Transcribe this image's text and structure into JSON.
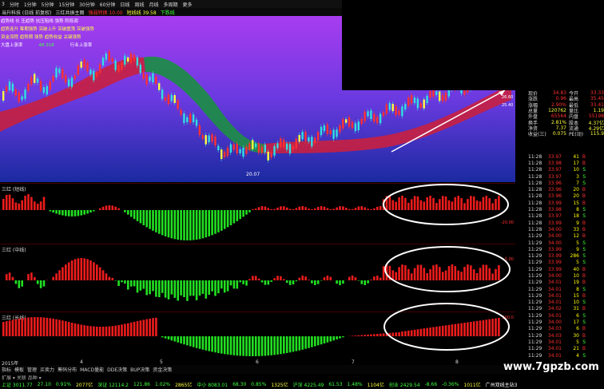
{
  "menubar": {
    "items": [
      "3",
      "分时",
      "1分钟",
      "5分钟",
      "15分钟",
      "30分钟",
      "60分钟",
      "日线",
      "周线",
      "月线",
      "多周期",
      "更多"
    ]
  },
  "toolbar": {
    "items": [
      {
        "label": "当升科技 (日线 前复权)",
        "color": "#dddddd"
      },
      {
        "label": "三红共振主图",
        "color": "#dddddd"
      },
      {
        "label": "强弱转换 10.00",
        "color": "#ff3030"
      },
      {
        "label": "短线线 39.58",
        "color": "#ffff40"
      },
      {
        "label": "下跌线",
        "color": "#40ff40"
      }
    ]
  },
  "main_overlay": {
    "labels": [
      {
        "text": "趋势线 长 压趋势 抗压阻线 强势 阶段调",
        "color": "#ffffff"
      },
      {
        "text": "趋势连升 筹期强势 突破上升 突破震荡 突破强势",
        "color": "#ffff40"
      },
      {
        "text": "资金流程 趋势期 强势 趋势收益 关键强势",
        "color": "#ffff40"
      },
      {
        "text": "大盘上涨率",
        "color": "#ffffff"
      },
      {
        "text": "48.318",
        "color": "#40ff40"
      },
      {
        "text": "行业上涨率",
        "color": "#ffffff"
      }
    ],
    "price_low": "20.07",
    "right_labels": [
      "26.60",
      "25.40"
    ]
  },
  "quote": {
    "rows": [
      {
        "k": "现价",
        "v": "34.83",
        "k2": "今开",
        "v2": "33.33",
        "vc": "#ff3030"
      },
      {
        "k": "涨跌",
        "v": "0.96",
        "k2": "最高",
        "v2": "35.45",
        "vc": "#ff3030"
      },
      {
        "k": "涨幅",
        "v": "2.90%",
        "k2": "最低",
        "v2": "33.41",
        "vc": "#ff3030"
      },
      {
        "k": "总量",
        "v": "120762",
        "k2": "量比",
        "v2": "1.19",
        "vc": "#ffff40"
      },
      {
        "k": "外盘",
        "v": "65564",
        "k2": "内盘",
        "v2": "55198",
        "vc": "#ff3030"
      },
      {
        "k": "换手",
        "v": "2.81%",
        "k2": "股本",
        "v2": "4.37亿",
        "vc": "#ffff40"
      },
      {
        "k": "净资",
        "v": "7.37",
        "k2": "流通",
        "v2": "4.29亿",
        "vc": "#ffff40"
      },
      {
        "k": "收益(三)",
        "v": "0.075",
        "k2": "PE(动)",
        "v2": "115.9",
        "vc": "#ffff40"
      }
    ]
  },
  "ticks": {
    "rows": [
      {
        "t": "11:28",
        "p": "33.97",
        "v": "41",
        "d": "B",
        "pc": "#ff3030"
      },
      {
        "t": "11:28",
        "p": "33.98",
        "v": "17",
        "d": "B",
        "pc": "#ff3030"
      },
      {
        "t": "11:28",
        "p": "33.97",
        "v": "10",
        "d": "S",
        "pc": "#ff3030"
      },
      {
        "t": "11:28",
        "p": "33.97",
        "v": "3",
        "d": "S",
        "pc": "#ff3030"
      },
      {
        "t": "11:28",
        "p": "33.96",
        "v": "7",
        "d": "S",
        "pc": "#ff3030"
      },
      {
        "t": "11:28",
        "p": "33.96",
        "v": "20",
        "d": "B",
        "pc": "#ff3030"
      },
      {
        "t": "11:28",
        "p": "33.96",
        "v": "20",
        "d": "B",
        "pc": "#ff3030"
      },
      {
        "t": "11:28",
        "p": "33.99",
        "v": "15",
        "d": "B",
        "pc": "#ff3030"
      },
      {
        "t": "11:28",
        "p": "33.98",
        "v": "8",
        "d": "S",
        "pc": "#ff3030"
      },
      {
        "t": "11:28",
        "p": "33.97",
        "v": "18",
        "d": "S",
        "pc": "#ff3030"
      },
      {
        "t": "11:28",
        "p": "33.99",
        "v": "9",
        "d": "B",
        "pc": "#ff3030"
      },
      {
        "t": "11:28",
        "p": "34.00",
        "v": "33",
        "d": "B",
        "pc": "#ff3030"
      },
      {
        "t": "11:29",
        "p": "34.00",
        "v": "12",
        "d": "B",
        "pc": "#ff3030"
      },
      {
        "t": "11:29",
        "p": "34.00",
        "v": "5",
        "d": "S",
        "pc": "#ff3030"
      },
      {
        "t": "11:29",
        "p": "33.99",
        "v": "9",
        "d": "S",
        "pc": "#ff3030"
      },
      {
        "t": "11:29",
        "p": "33.99",
        "v": "286",
        "d": "S",
        "pc": "#ff3030"
      },
      {
        "t": "11:29",
        "p": "33.99",
        "v": "5",
        "d": "S",
        "pc": "#ff3030"
      },
      {
        "t": "11:29",
        "p": "33.99",
        "v": "40",
        "d": "B",
        "pc": "#ff3030"
      },
      {
        "t": "11:29",
        "p": "34.00",
        "v": "10",
        "d": "B",
        "pc": "#ff3030"
      },
      {
        "t": "11:29",
        "p": "34.01",
        "v": "19",
        "d": "B",
        "pc": "#ff3030"
      },
      {
        "t": "11:29",
        "p": "34.01",
        "v": "8",
        "d": "S",
        "pc": "#ff3030"
      },
      {
        "t": "11:29",
        "p": "34.01",
        "v": "15",
        "d": "B",
        "pc": "#ff3030"
      },
      {
        "t": "11:29",
        "p": "34.01",
        "v": "10",
        "d": "S",
        "pc": "#ff3030"
      },
      {
        "t": "11:29",
        "p": "34.02",
        "v": "31",
        "d": "B",
        "pc": "#ff3030"
      },
      {
        "t": "11:29",
        "p": "34.01",
        "v": "6",
        "d": "S",
        "pc": "#ff3030"
      },
      {
        "t": "11:29",
        "p": "34.00",
        "v": "17",
        "d": "S",
        "pc": "#ff3030"
      },
      {
        "t": "11:29",
        "p": "34.03",
        "v": "6",
        "d": "B",
        "pc": "#ff3030"
      },
      {
        "t": "11:29",
        "p": "34.03",
        "v": "30",
        "d": "B",
        "pc": "#ff3030"
      },
      {
        "t": "11:29",
        "p": "34.01",
        "v": "5",
        "d": "S",
        "pc": "#ff3030"
      },
      {
        "t": "11:29",
        "p": "34.01",
        "v": "21",
        "d": "B",
        "pc": "#ff3030"
      },
      {
        "t": "11:29",
        "p": "34.01",
        "v": "4",
        "d": "S",
        "pc": "#ff3030"
      }
    ]
  },
  "subcharts": [
    {
      "title": "三红 (短线)",
      "axis_top": "",
      "axis_bot": "-20.00"
    },
    {
      "title": "三红 (中线)",
      "axis_top": "5.00",
      "axis_bot": "-5.00"
    },
    {
      "title": "三红 (长线)",
      "axis_top": "200.0",
      "axis_bot": "-100.0"
    }
  ],
  "date_axis": {
    "first": "2015年",
    "marks": [
      "4",
      "5",
      "6",
      "7",
      "8"
    ]
  },
  "bottom_tabs": [
    "指标",
    "模板",
    "管理",
    "买卖力",
    "筹码分布",
    "MACD量能",
    "DDE决策",
    "BUP决策",
    "资金决策"
  ],
  "bottom_sub": "扩展 ▾ 关联 品种 ▾",
  "status": [
    {
      "label": "上证",
      "value": "3011.77",
      "color": "#40ff40"
    },
    {
      "label": "",
      "value": "27.10",
      "color": "#40ff40"
    },
    {
      "label": "",
      "value": "0.91%",
      "color": "#40ff40"
    },
    {
      "label": "",
      "value": "2077亿",
      "color": "#ffff40"
    },
    {
      "label": "深证",
      "value": "12114.2",
      "color": "#40ff40"
    },
    {
      "label": "",
      "value": "121.86",
      "color": "#40ff40"
    },
    {
      "label": "",
      "value": "1.02%",
      "color": "#40ff40"
    },
    {
      "label": "",
      "value": "2865亿",
      "color": "#ffff40"
    },
    {
      "label": "中小",
      "value": "8083.01",
      "color": "#40ff40"
    },
    {
      "label": "",
      "value": "68.30",
      "color": "#40ff40"
    },
    {
      "label": "",
      "value": "0.85%",
      "color": "#40ff40"
    },
    {
      "label": "",
      "value": "1325亿",
      "color": "#ffff40"
    },
    {
      "label": "沪深",
      "value": "4225.49",
      "color": "#40ff40"
    },
    {
      "label": "",
      "value": "61.53",
      "color": "#40ff40"
    },
    {
      "label": "",
      "value": "1.48%",
      "color": "#40ff40"
    },
    {
      "label": "",
      "value": "1104亿",
      "color": "#ffff40"
    },
    {
      "label": "创业",
      "value": "2429.54",
      "color": "#40ff40"
    },
    {
      "label": "",
      "value": "-8.66",
      "color": "#40ff40"
    },
    {
      "label": "",
      "value": "-0.36%",
      "color": "#40ff40"
    },
    {
      "label": "",
      "value": "1011亿",
      "color": "#ffff40"
    },
    {
      "label": "",
      "value": "广州双线主站3",
      "color": "#ffffff"
    }
  ],
  "watermark": "www.7gpzb.com",
  "colors": {
    "up": "#ff2020",
    "down": "#20e020",
    "bg_top": "#9a3df0",
    "bg_bottom": "#1a1a80"
  }
}
